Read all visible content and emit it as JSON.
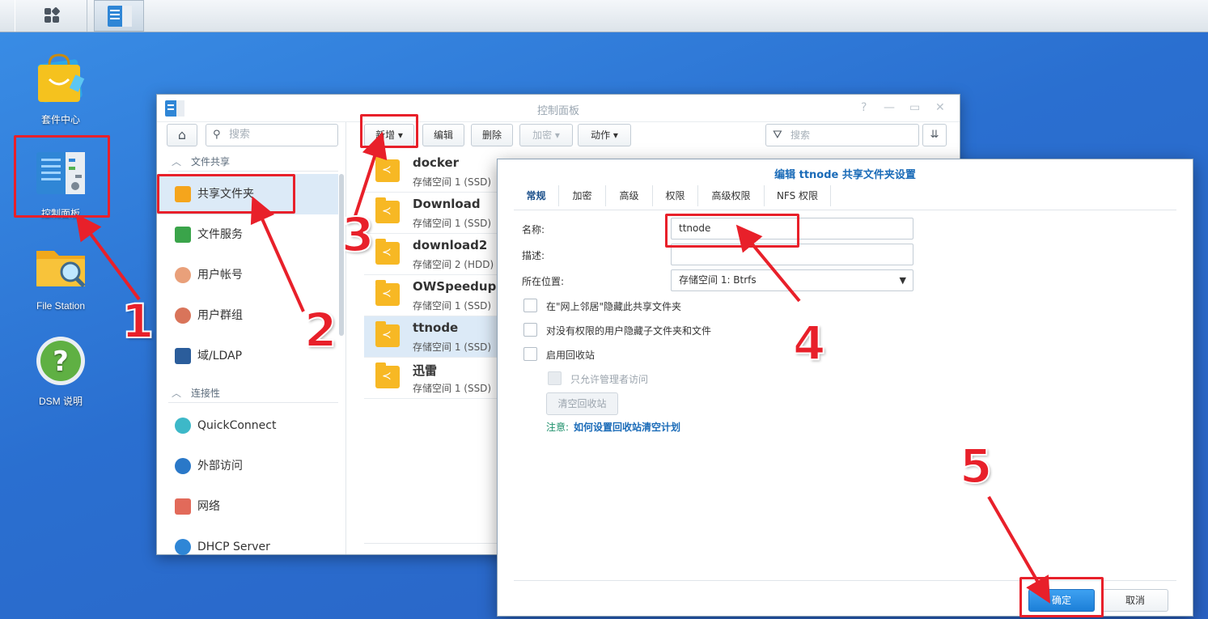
{
  "desktop": {
    "icons": [
      {
        "label": "套件中心"
      },
      {
        "label": "控制面板"
      },
      {
        "label": "File Station"
      },
      {
        "label": "DSM 说明"
      }
    ]
  },
  "control_panel": {
    "title": "控制面板",
    "side_search_placeholder": "搜索",
    "sections": [
      {
        "label": "文件共享"
      },
      {
        "label": "连接性"
      }
    ],
    "side_items": [
      {
        "label": "共享文件夹"
      },
      {
        "label": "文件服务"
      },
      {
        "label": "用户帐号"
      },
      {
        "label": "用户群组"
      },
      {
        "label": "域/LDAP"
      },
      {
        "label": "QuickConnect"
      },
      {
        "label": "外部访问"
      },
      {
        "label": "网络"
      },
      {
        "label": "DHCP Server"
      }
    ],
    "toolbar": {
      "new": "新增",
      "edit": "编辑",
      "delete": "删除",
      "encrypt": "加密",
      "action": "动作",
      "search_placeholder": "搜索"
    },
    "folders": [
      {
        "name": "docker",
        "location": "存储空间 1 (SSD)"
      },
      {
        "name": "Download",
        "location": "存储空间 1 (SSD)"
      },
      {
        "name": "download2",
        "location": "存储空间 2 (HDD)"
      },
      {
        "name": "OWSpeedup",
        "location": "存储空间 1 (SSD)"
      },
      {
        "name": "ttnode",
        "location": "存储空间 1 (SSD)"
      },
      {
        "name": "迅雷",
        "location": "存储空间 1 (SSD)"
      }
    ]
  },
  "dialog": {
    "title": "编辑 ttnode 共享文件夹设置",
    "tabs": [
      "常规",
      "加密",
      "高级",
      "权限",
      "高级权限",
      "NFS 权限"
    ],
    "name_label": "名称:",
    "name_value": "ttnode",
    "desc_label": "描述:",
    "desc_value": "",
    "location_label": "所在位置:",
    "location_value": "存储空间 1:  Btrfs",
    "checkboxes": [
      {
        "label": "在\"网上邻居\"隐藏此共享文件夹"
      },
      {
        "label": "对没有权限的用户隐藏子文件夹和文件"
      },
      {
        "label": "启用回收站"
      },
      {
        "label": "只允许管理者访问"
      }
    ],
    "clear_button": "清空回收站",
    "note_label": "注意:",
    "note_link": "如何设置回收站清空计划",
    "ok_button": "确定",
    "cancel_button": "取消"
  },
  "annotations": {
    "steps": [
      "1",
      "2",
      "3",
      "4",
      "5"
    ],
    "color": "#e8202a"
  }
}
